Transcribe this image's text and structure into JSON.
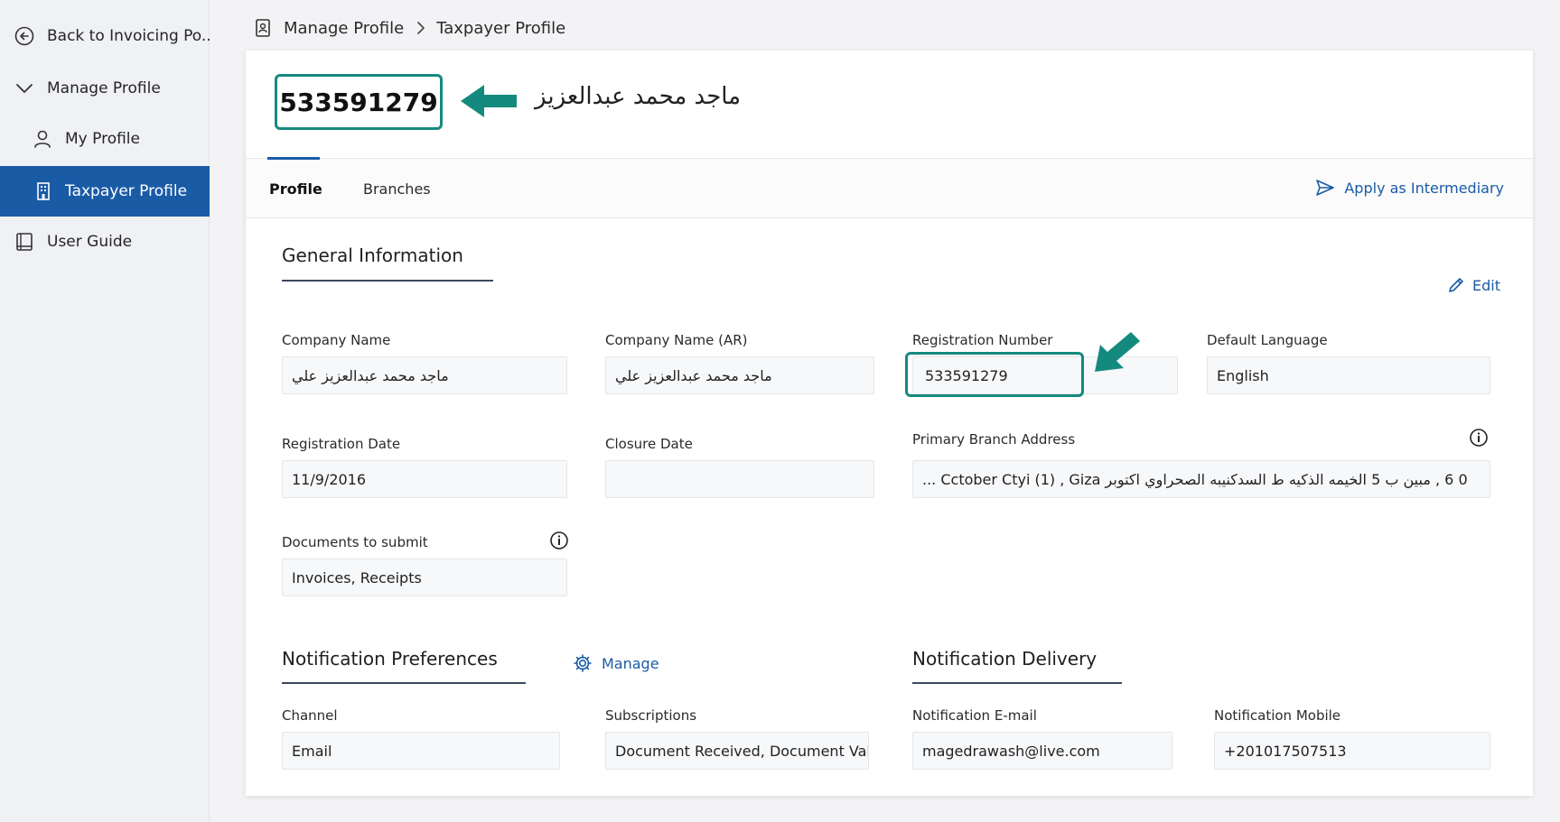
{
  "sidebar": {
    "back": "Back to Invoicing Po...",
    "manage_profile": "Manage Profile",
    "my_profile": "My Profile",
    "taxpayer_profile": "Taxpayer Profile",
    "user_guide": "User Guide"
  },
  "breadcrumb": {
    "root": "Manage Profile",
    "current": "Taxpayer Profile"
  },
  "header": {
    "taxpayer_id": "533591279",
    "arabic_name": "ماجد محمد عبدالعزيز"
  },
  "tabs": [
    {
      "label": "Profile",
      "active": true
    },
    {
      "label": "Branches",
      "active": false
    }
  ],
  "actions": {
    "apply_intermediary": "Apply as Intermediary",
    "edit": "Edit",
    "manage": "Manage"
  },
  "general": {
    "title": "General Information",
    "company_name_label": "Company Name",
    "company_name": "ماجد محمد عبدالعزيز علي",
    "company_name_ar_label": "Company Name (AR)",
    "company_name_ar": "ماجد محمد عبدالعزيز علي",
    "registration_number_label": "Registration Number",
    "registration_number": "533591279",
    "default_language_label": "Default Language",
    "default_language": "English",
    "registration_date_label": "Registration Date",
    "registration_date": "11/9/2016",
    "closure_date_label": "Closure Date",
    "closure_date": "",
    "primary_branch_label": "Primary Branch Address",
    "primary_branch": "0 6 , مبين ب 5 الخيمه الذكيه ط السدكنيبه الصحراوي اكتوبر Cctober Ctyi (1) , Giza ...",
    "documents_label": "Documents to submit",
    "documents": "Invoices, Receipts"
  },
  "notification_prefs": {
    "title": "Notification Preferences",
    "channel_label": "Channel",
    "channel": "Email",
    "subscriptions_label": "Subscriptions",
    "subscriptions": "Document Received, Document Vali..."
  },
  "notification_delivery": {
    "title": "Notification Delivery",
    "email_label": "Notification E-mail",
    "email": "magedrawash@live.com",
    "mobile_label": "Notification Mobile",
    "mobile": "+201017507513"
  },
  "colors": {
    "primary": "#1a5ba6",
    "highlight": "#148a7f"
  }
}
